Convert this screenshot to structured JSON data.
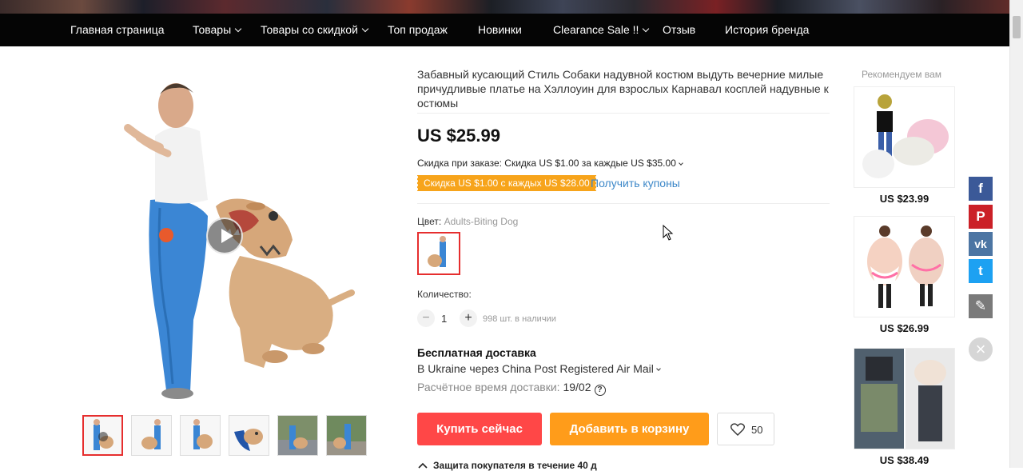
{
  "nav": {
    "items": [
      {
        "label": "Главная страница",
        "dropdown": false
      },
      {
        "label": "Товары",
        "dropdown": true
      },
      {
        "label": "Товары со скидкой",
        "dropdown": true
      },
      {
        "label": "Топ продаж",
        "dropdown": false
      },
      {
        "label": "Новинки",
        "dropdown": false
      },
      {
        "label": "Clearance Sale !!",
        "dropdown": true
      },
      {
        "label": "Отзыв",
        "dropdown": false
      },
      {
        "label": "История бренда",
        "dropdown": false
      }
    ]
  },
  "product": {
    "title": "Забавный кусающий Стиль Собаки надувной костюм выдуть вечерние милые причудливые платье на Хэллоуин для взрослых Карнавал косплей надувные костюмы",
    "price": "US $25.99",
    "order_discount": "Скидка при заказе: Скидка US $1.00 за каждые US $35.00",
    "coupon_tag": "Скидка US $1.00 с каждых US $28.00",
    "get_coupons": "Получить купоны",
    "color_label": "Цвет:",
    "color_value": "Adults-Biting Dog",
    "quantity_label": "Количество:",
    "quantity": "1",
    "stock": "998 шт. в наличии",
    "shipping_title": "Бесплатная доставка",
    "shipping_method": "В Ukraine через China Post Registered Air Mail",
    "eta_label": "Расчётное время доставки:",
    "eta_date": "19/02",
    "buy_now": "Купить сейчас",
    "add_to_cart": "Добавить в корзину",
    "wishlist_count": "50",
    "protection": "Защита покупателя в течение 40 д"
  },
  "gallery": {
    "thumbnail_count": 6,
    "active_index": 0,
    "has_video": true
  },
  "recommend": {
    "title": "Рекомендуем вам",
    "items": [
      {
        "price": "US $23.99"
      },
      {
        "price": "US $26.99"
      },
      {
        "price": "US $38.49"
      }
    ]
  },
  "share": {
    "buttons": [
      {
        "icon": "facebook-icon",
        "glyph": "f",
        "color": "#3b5998"
      },
      {
        "icon": "pinterest-icon",
        "glyph": "P",
        "color": "#cb2027"
      },
      {
        "icon": "vk-icon",
        "glyph": "vk",
        "color": "#4c75a3"
      },
      {
        "icon": "twitter-icon",
        "glyph": "t",
        "color": "#1da1f2"
      },
      {
        "icon": "edit-icon",
        "glyph": "✎",
        "color": "#7a7a7a"
      }
    ]
  },
  "colors": {
    "buy": "#ff4747",
    "cart": "#ff9c1a",
    "coupon": "#f7a41b",
    "link": "#3c87c8",
    "selected_border": "#e62e2e"
  }
}
